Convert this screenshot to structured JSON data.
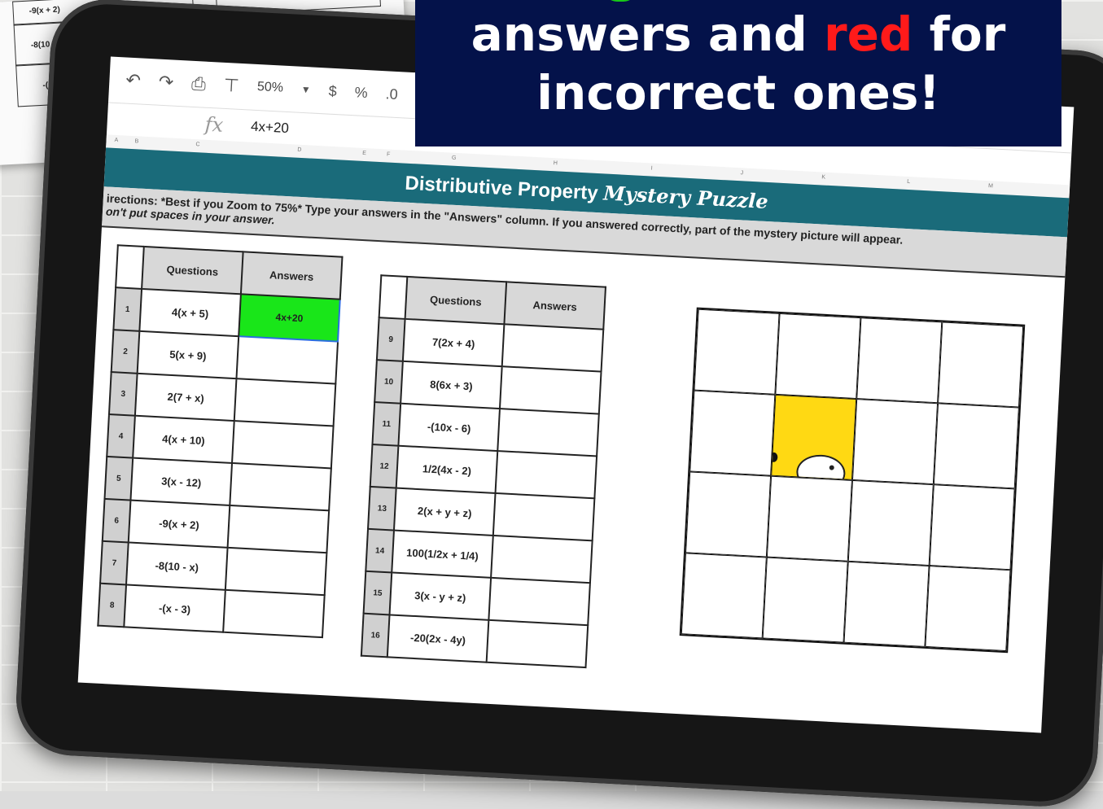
{
  "headline": {
    "line1_before": "answers and ",
    "line1_red": "red",
    "line1_after": " for",
    "line2": "incorrect ones!"
  },
  "toolbar": {
    "zoom": "50%",
    "currency": "$",
    "percent": "%",
    "decimal": ".0"
  },
  "formula_bar": {
    "fx": "fx",
    "value": "4x+20"
  },
  "columns": [
    "A",
    "B",
    "C",
    "D",
    "E",
    "F",
    "G",
    "H",
    "I",
    "J",
    "K",
    "L",
    "M"
  ],
  "sheet": {
    "title": "Distributive Property",
    "title_script": "Mystery Puzzle",
    "directions_line1": "irections: *Best if you Zoom to 75%* Type your answers in the \"Answers\" column. If you answered correctly, part of the mystery picture will appear.",
    "directions_line2": "on't put spaces in your answer."
  },
  "table1": {
    "header_questions": "Questions",
    "header_answers": "Answers",
    "rows": [
      {
        "num": "1",
        "q": "4(x + 5)",
        "a": "4x+20"
      },
      {
        "num": "2",
        "q": "5(x + 9)",
        "a": ""
      },
      {
        "num": "3",
        "q": "2(7 + x)",
        "a": ""
      },
      {
        "num": "4",
        "q": "4(x + 10)",
        "a": ""
      },
      {
        "num": "5",
        "q": "3(x - 12)",
        "a": ""
      },
      {
        "num": "6",
        "q": "-9(x + 2)",
        "a": ""
      },
      {
        "num": "7",
        "q": "-8(10 - x)",
        "a": ""
      },
      {
        "num": "8",
        "q": "-(x - 3)",
        "a": ""
      }
    ]
  },
  "table2": {
    "header_questions": "Questions",
    "header_answers": "Answers",
    "rows": [
      {
        "num": "9",
        "q": "7(2x + 4)",
        "a": ""
      },
      {
        "num": "10",
        "q": "8(6x + 3)",
        "a": ""
      },
      {
        "num": "11",
        "q": "-(10x - 6)",
        "a": ""
      },
      {
        "num": "12",
        "q": "1/2(4x - 2)",
        "a": ""
      },
      {
        "num": "13",
        "q": "2(x + y + z)",
        "a": ""
      },
      {
        "num": "14",
        "q": "100(1/2x + 1/4)",
        "a": ""
      },
      {
        "num": "15",
        "q": "3(x - y + z)",
        "a": ""
      },
      {
        "num": "16",
        "q": "-20(2x - 4y)",
        "a": ""
      }
    ]
  },
  "paper": {
    "labels": [
      "-9(x + 2)",
      "-8(10",
      "-("
    ]
  },
  "colors": {
    "banner": "#1a6b7a",
    "headline_bg": "#04124a",
    "correct": "#19e619",
    "reveal": "#ffd913",
    "red": "#ff1a1a"
  }
}
